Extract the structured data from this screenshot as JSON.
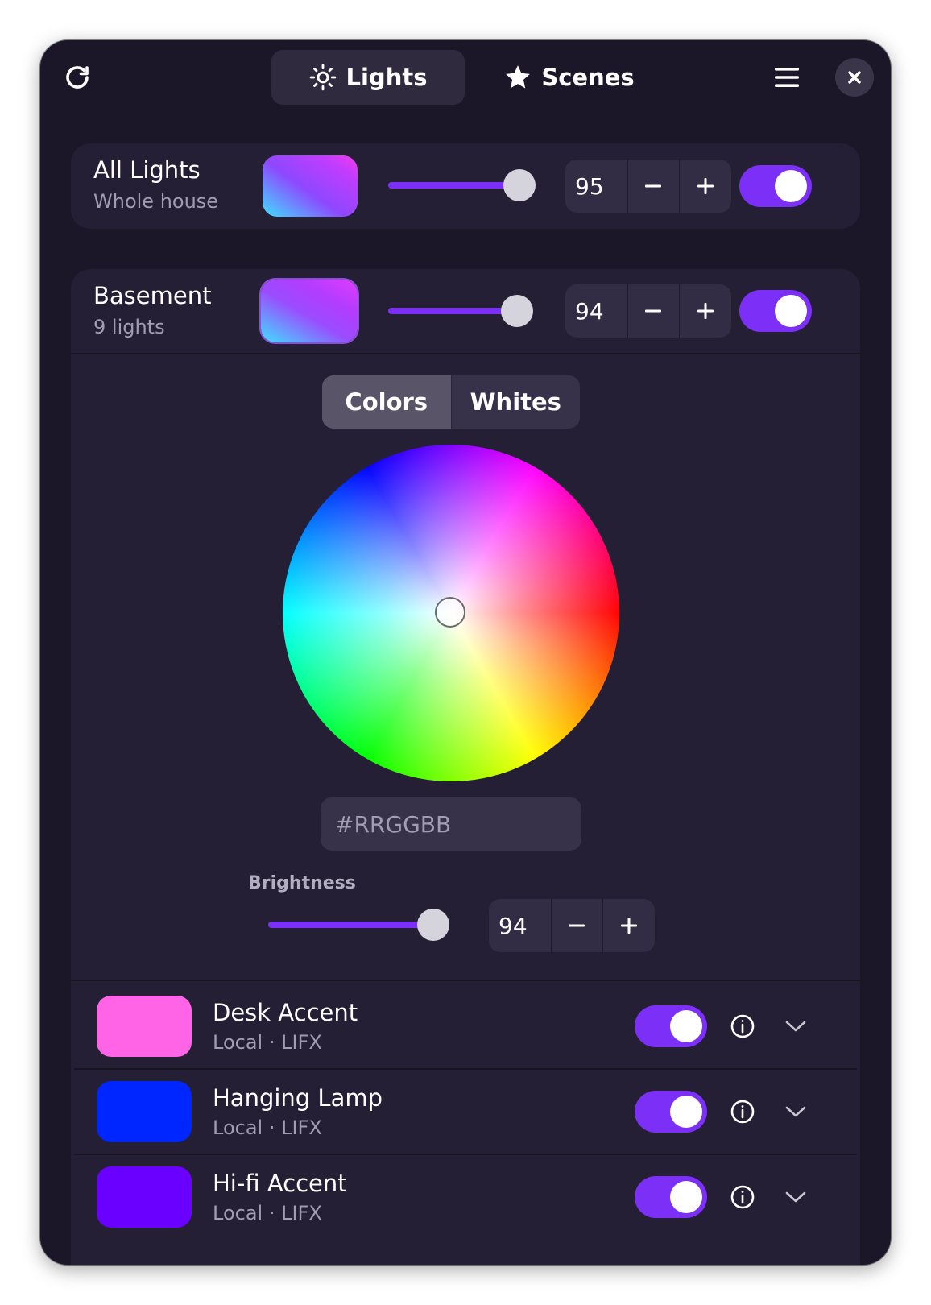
{
  "header": {
    "tabs": [
      {
        "label": "Lights",
        "icon": "sun-icon",
        "active": true
      },
      {
        "label": "Scenes",
        "icon": "star-icon",
        "active": false
      }
    ]
  },
  "all_lights": {
    "title": "All Lights",
    "subtitle": "Whole house",
    "brightness": 95,
    "brightness_text": "95",
    "on": true
  },
  "group": {
    "title": "Basement",
    "subtitle": "9 lights",
    "brightness": 94,
    "brightness_text": "94",
    "on": true,
    "picker": {
      "tabs": [
        {
          "label": "Colors",
          "active": true
        },
        {
          "label": "Whites",
          "active": false
        }
      ],
      "hex_placeholder": "#RRGGBB",
      "brightness_label": "Brightness",
      "brightness": 94,
      "brightness_text": "94"
    }
  },
  "lights": [
    {
      "name": "Desk Accent",
      "source": "Local · LIFX",
      "color": "#ff63e6",
      "on": true
    },
    {
      "name": "Hanging Lamp",
      "source": "Local · LIFX",
      "color": "#0026ff",
      "on": true
    },
    {
      "name": "Hi-fi Accent",
      "source": "Local · LIFX",
      "color": "#6a00ff",
      "on": true
    }
  ],
  "colors": {
    "accent": "#7b2ff7",
    "window_bg": "#1b1628",
    "card_bg": "#251f36"
  }
}
